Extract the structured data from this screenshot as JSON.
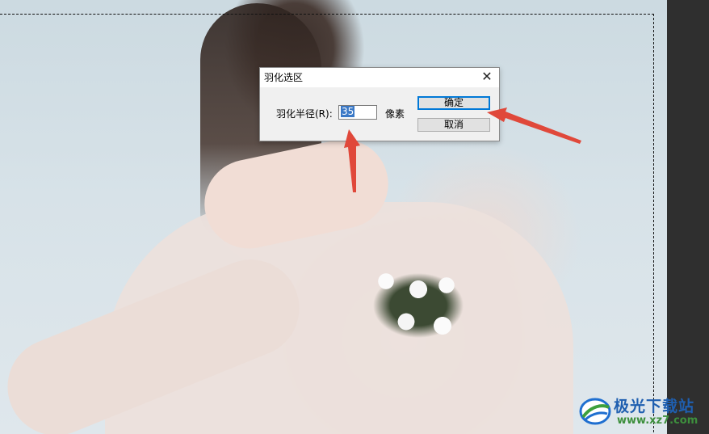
{
  "dialog": {
    "title": "羽化选区",
    "close_glyph": "✕",
    "radius_label": "羽化半径(R):",
    "radius_value": "35",
    "unit": "像素",
    "ok_label": "确定",
    "cancel_label": "取消"
  },
  "watermark": {
    "name": "极光下载站",
    "url": "www.xz7.com"
  },
  "colors": {
    "arrow": "#e0483a",
    "ok_focus": "#0078d7",
    "selected_text_bg": "#3a78c6"
  }
}
